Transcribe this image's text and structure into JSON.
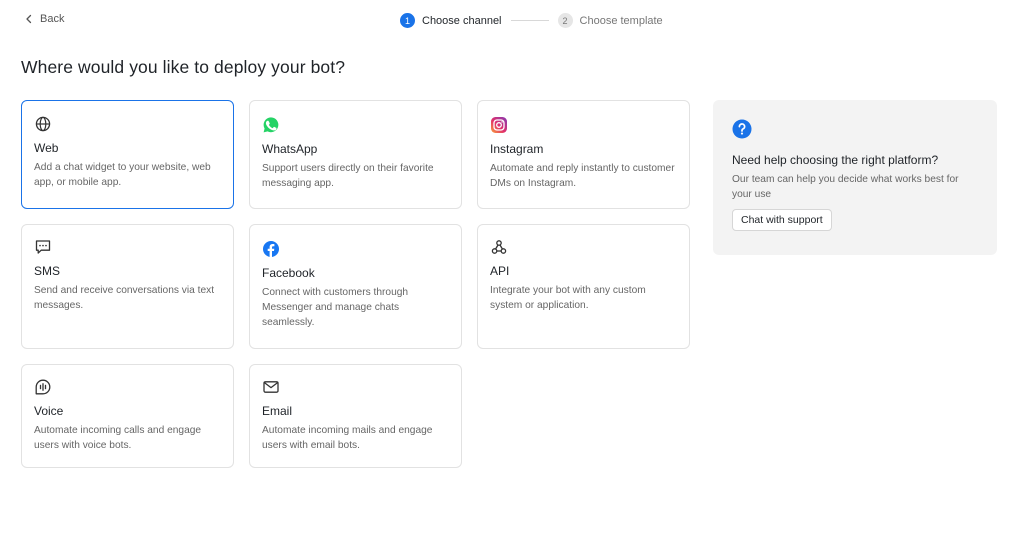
{
  "nav": {
    "back_label": "Back"
  },
  "stepper": {
    "steps": [
      {
        "number": "1",
        "label": "Choose channel"
      },
      {
        "number": "2",
        "label": "Choose template"
      }
    ]
  },
  "page": {
    "title": "Where would you like to deploy your bot?"
  },
  "channels": [
    {
      "title": "Web",
      "description": "Add a chat widget to your website, web app, or mobile app.",
      "icon": "globe-icon"
    },
    {
      "title": "WhatsApp",
      "description": "Support users directly on their favorite messaging app.",
      "icon": "whatsapp-icon"
    },
    {
      "title": "Instagram",
      "description": "Automate and reply instantly to customer DMs on Instagram.",
      "icon": "instagram-icon"
    },
    {
      "title": "SMS",
      "description": "Send and receive conversations via text messages.",
      "icon": "sms-icon"
    },
    {
      "title": "Facebook",
      "description": "Connect with customers through Messenger and manage chats seamlessly.",
      "icon": "facebook-icon"
    },
    {
      "title": "API",
      "description": "Integrate your bot with any custom system or application.",
      "icon": "webhook-icon"
    },
    {
      "title": "Voice",
      "description": "Automate incoming calls and engage users with voice bots.",
      "icon": "voice-icon"
    },
    {
      "title": "Email",
      "description": "Automate incoming mails and engage users with email bots.",
      "icon": "mail-icon"
    }
  ],
  "help": {
    "title": "Need help choosing the right platform?",
    "description": "Our team can help you decide what works best for your use",
    "button_label": "Chat with support"
  },
  "colors": {
    "accent": "#1a73e8",
    "whatsapp": "#25d366",
    "facebook": "#1877f2",
    "help_bg": "#f3f3f3"
  }
}
